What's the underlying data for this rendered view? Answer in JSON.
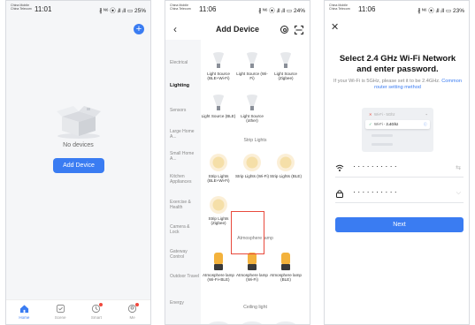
{
  "status_bar": {
    "carrier_1": "China Mobile",
    "carrier_2": "China Telecom",
    "phone1": {
      "time": "11:01",
      "icons": "∦ ᴺ⁶ ⦿ ᵢll ᵢll ▭ 25%"
    },
    "phone2": {
      "time": "11:06",
      "icons": "∦ ᴺ⁶ ⦿ ᵢll ᵢll ▭ 24%"
    },
    "phone3": {
      "time": "11:06",
      "icons": "∦ ᴺ⁶ ⦿ ᵢll ᵢll ▭ 23%"
    }
  },
  "home": {
    "add_icon": "plus-icon",
    "empty_text": "No devices",
    "add_device_label": "Add Device",
    "tabs": [
      {
        "label": "Home",
        "icon": "home-icon"
      },
      {
        "label": "Scene",
        "icon": "scene-icon"
      },
      {
        "label": "Smart",
        "icon": "smart-icon"
      },
      {
        "label": "Me",
        "icon": "me-icon"
      }
    ]
  },
  "add_device": {
    "title": "Add Device",
    "categories": [
      "Electrical",
      "Lighting",
      "Sensors",
      "Large Home A...",
      "Small Home A...",
      "Kitchen Appliances",
      "Exercise & Health",
      "Camera & Lock",
      "Gateway Control",
      "Outdoor Travel",
      "Energy"
    ],
    "sections": {
      "strip": "Strip Lights",
      "atmosphere": "Atmosphere lamp",
      "ceiling": "Ceiling light"
    },
    "light_sources": [
      "Light Source (BLE+Wi-Fi)",
      "Light Source (Wi-Fi)",
      "Light Source (Zigbee)",
      "Light Source (BLE)",
      "Light Source (other)"
    ],
    "strips": [
      "Strip Lights (BLE+Wi-Fi)",
      "Strip Lights (Wi-Fi)",
      "Strip Lights (BLE)",
      "Strip Lights (Zigbee)"
    ],
    "atmos": [
      "Atmosphere lamp (Wi-Fi+BLE)",
      "Atmosphere lamp (Wi-Fi)",
      "Atmosphere lamp (BLE)"
    ]
  },
  "wifi": {
    "title": "Select 2.4 GHz Wi-Fi Network and enter password.",
    "subtitle": "If your Wi-Fi is 5GHz, please set it to be 2.4GHz.",
    "link": "Common router setting method",
    "bad_row": "Wi-Fi - 5Ghz",
    "good_row_prefix": "Wi-Fi - ",
    "good_row_band": "2.4Ghz",
    "ssid_mask": "··········",
    "password_mask": "··········",
    "next_label": "Next",
    "colors": {
      "accent": "#3a7cf2",
      "error": "#e84a3c",
      "ok": "#2fb36b"
    }
  }
}
